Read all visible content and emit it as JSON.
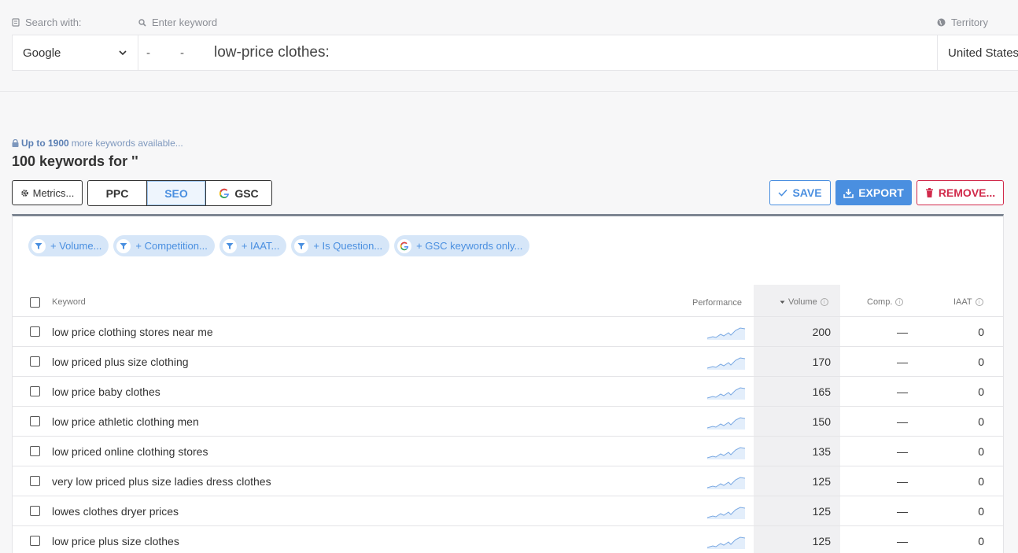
{
  "search": {
    "search_with_label": "Search with:",
    "keyword_label": "Enter keyword",
    "territory_label": "Territory",
    "engine": "Google",
    "dash1": "-",
    "dash2": "-",
    "query": "low-price clothes:",
    "territory": "United States"
  },
  "availability": {
    "prefix": "Up to 1900",
    "suffix": "more keywords available..."
  },
  "title": "100 keywords for ''",
  "toolbar": {
    "metrics": "Metrics...",
    "ppc": "PPC",
    "seo": "SEO",
    "gsc": "GSC",
    "save": "SAVE",
    "export": "EXPORT",
    "remove": "REMOVE..."
  },
  "filters": [
    {
      "label": "+ Volume...",
      "icon": "filter-icon"
    },
    {
      "label": "+ Competition...",
      "icon": "filter-icon"
    },
    {
      "label": "+ IAAT...",
      "icon": "filter-icon"
    },
    {
      "label": "+ Is Question...",
      "icon": "filter-icon"
    },
    {
      "label": "+ GSC keywords only...",
      "icon": "google-icon"
    }
  ],
  "table": {
    "headers": {
      "keyword": "Keyword",
      "performance": "Performance",
      "volume": "Volume",
      "comp": "Comp.",
      "iaat": "IAAT"
    },
    "rows": [
      {
        "keyword": "low price clothing stores near me",
        "volume": "200",
        "comp": "—",
        "iaat": "0"
      },
      {
        "keyword": "low priced plus size clothing",
        "volume": "170",
        "comp": "—",
        "iaat": "0"
      },
      {
        "keyword": "low price baby clothes",
        "volume": "165",
        "comp": "—",
        "iaat": "0"
      },
      {
        "keyword": "low price athletic clothing men",
        "volume": "150",
        "comp": "—",
        "iaat": "0"
      },
      {
        "keyword": "low priced online clothing stores",
        "volume": "135",
        "comp": "—",
        "iaat": "0"
      },
      {
        "keyword": "very low priced plus size ladies dress clothes",
        "volume": "125",
        "comp": "—",
        "iaat": "0"
      },
      {
        "keyword": "lowes clothes dryer prices",
        "volume": "125",
        "comp": "—",
        "iaat": "0"
      },
      {
        "keyword": "low price plus size clothes",
        "volume": "125",
        "comp": "—",
        "iaat": "0"
      }
    ]
  },
  "colors": {
    "accent": "#4a8fe0",
    "danger": "#d12a4b",
    "chip_bg": "#d6e6f8"
  }
}
